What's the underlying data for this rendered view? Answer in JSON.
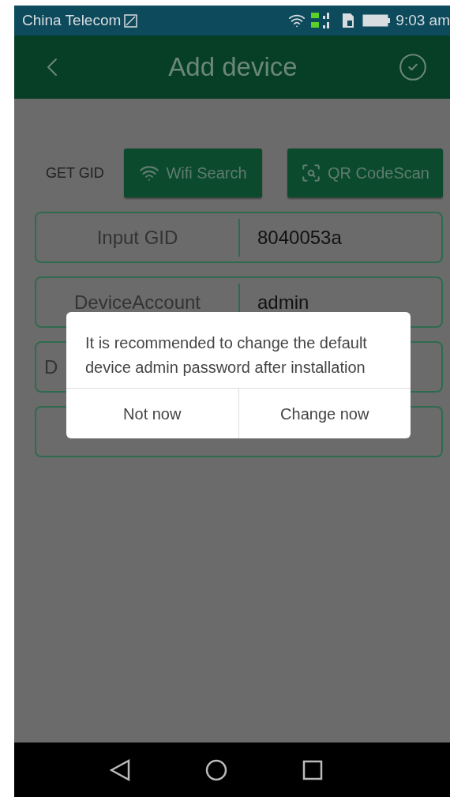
{
  "status_bar": {
    "carrier": "China Telecom",
    "time": "9:03 am"
  },
  "header": {
    "title": "Add device"
  },
  "get_gid": {
    "label": "GET GID",
    "buttons": [
      "Wifi Search",
      "QR CodeScan"
    ]
  },
  "fields": [
    {
      "kind": "full",
      "label": "Input GID",
      "value": "8040053a"
    },
    {
      "kind": "full",
      "label": "DeviceAccount",
      "value": "admin"
    },
    {
      "kind": "partial",
      "label": "D"
    },
    {
      "kind": "empty"
    }
  ],
  "dialog": {
    "message": "It is recommended to change the default device admin password after installation",
    "buttons": [
      "Not now",
      "Change now"
    ]
  }
}
